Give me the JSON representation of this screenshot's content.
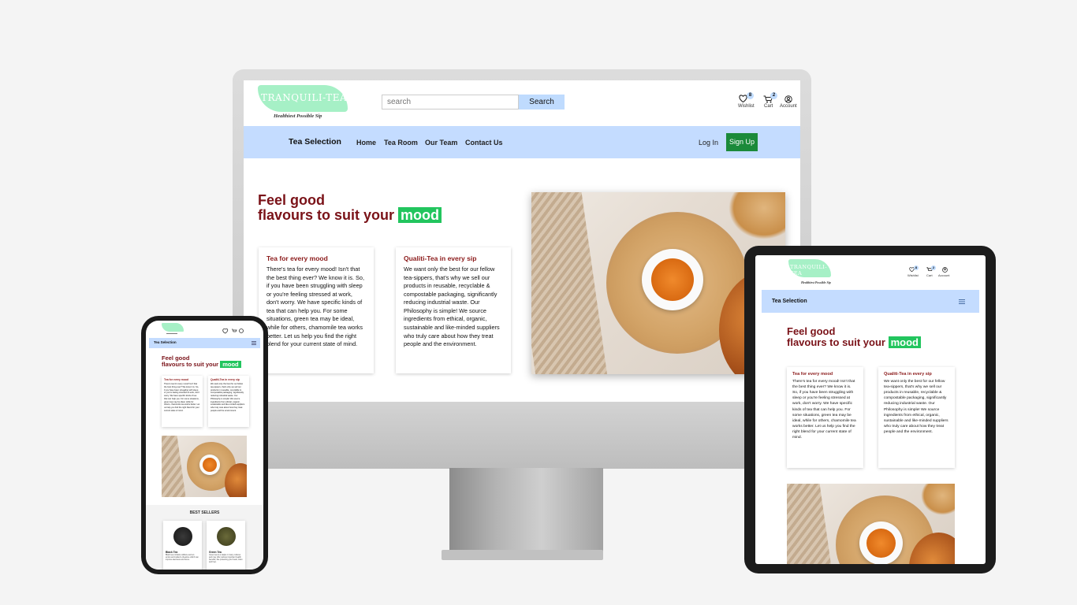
{
  "site": {
    "logo": "TRANQUILI-TEA",
    "tagline": "Healthiest Possible Sip",
    "search_placeholder": "search",
    "search_button": "Search",
    "wishlist_label": "Wishlist",
    "wishlist_count": "8",
    "cart_label": "Cart",
    "cart_count": "2",
    "account_label": "Account",
    "brand": "Tea Selection",
    "nav": [
      "Home",
      "Tea Room",
      "Our Team",
      "Contact Us"
    ],
    "login": "Log In",
    "signup": "Sign Up",
    "hero_line1": "Feel good",
    "hero_line2": "flavours to suit your",
    "hero_mood": "mood",
    "card1_title": "Tea for every mood",
    "card1_text": "There's tea for every mood! Isn't that the best thing ever? We know it is. So, if you have been struggling with sleep or you're feeling stressed at work, don't worry. We have specific kinds of tea that can help you. For some situations, green tea may be ideal, while for others, chamomile tea works better. Let us help you find the right blend for your current state of mind.",
    "card2_title": "Qualiti-Tea in every sip",
    "card2_text": "We want only the best for our fellow tea-sippers, that's why we sell our products in reusable, recyclable & compostable packaging, significantly reducing industrial waste. Our Philosophy is simple! We source ingredients from ethical, organic, sustainable and like-minded suppliers who truly care about how they treat people and the environment."
  },
  "phone": {
    "best_sellers": "BEST SELLERS",
    "products": [
      {
        "name": "Black Tea",
        "desc": "Black tea contains caffeine and an amino acid called L-theanine which can improve alertness and focus."
      },
      {
        "name": "Green Tea",
        "desc": "Green tea is a staple in many cultures and may offer various important health benefits, like protecting your heart, brain and liver."
      }
    ]
  },
  "colors": {
    "accent_green": "#22c55e",
    "nav_blue": "#c4dcff",
    "title_red": "#7a1218",
    "logo_mint": "#a6f0c6"
  }
}
